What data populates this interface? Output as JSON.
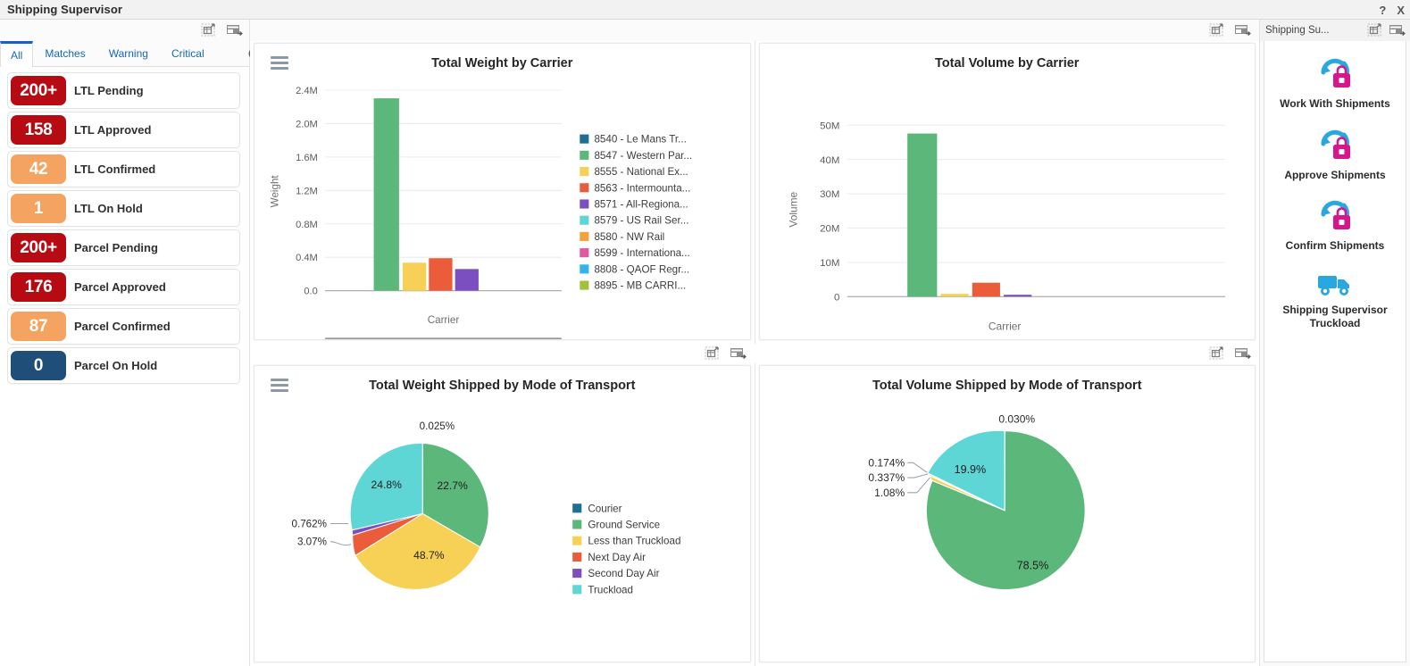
{
  "window": {
    "title": "Shipping Supervisor",
    "help_label": "?",
    "close_label": "X"
  },
  "left_panel": {
    "toolbar_icons": [
      "expand-grid-icon",
      "add-panel-icon"
    ],
    "tabs": [
      {
        "label": "All",
        "active": true
      },
      {
        "label": "Matches",
        "active": false
      },
      {
        "label": "Warning",
        "active": false
      },
      {
        "label": "Critical",
        "active": false
      }
    ],
    "refresh_icon": "refresh-icon",
    "kpis": [
      {
        "count": "200+",
        "label": "LTL Pending",
        "color": "#b60b12"
      },
      {
        "count": "158",
        "label": "LTL Approved",
        "color": "#b60b12"
      },
      {
        "count": "42",
        "label": "LTL Confirmed",
        "color": "#f4a460"
      },
      {
        "count": "1",
        "label": "LTL On Hold",
        "color": "#f4a460"
      },
      {
        "count": "200+",
        "label": "Parcel Pending",
        "color": "#b60b12"
      },
      {
        "count": "176",
        "label": "Parcel Approved",
        "color": "#b60b12"
      },
      {
        "count": "87",
        "label": "Parcel Confirmed",
        "color": "#f4a460"
      },
      {
        "count": "0",
        "label": "Parcel On Hold",
        "color": "#1f4e79"
      }
    ]
  },
  "right_panel": {
    "title": "Shipping Su...",
    "toolbar_icons": [
      "expand-grid-icon",
      "add-panel-icon"
    ],
    "apps": [
      {
        "label": "Work With Shipments",
        "icon": "shipments-briefcase-icon"
      },
      {
        "label": "Approve Shipments",
        "icon": "shipments-briefcase-icon"
      },
      {
        "label": "Confirm Shipments",
        "icon": "shipments-briefcase-icon"
      },
      {
        "label": "Shipping Supervisor Truckload",
        "icon": "truck-icon"
      }
    ]
  },
  "panel_toolbars": {
    "icons": [
      "expand-grid-icon",
      "add-panel-icon"
    ]
  },
  "chart_data": [
    {
      "type": "bar",
      "title": "Total Weight by Carrier",
      "xlabel": "Carrier",
      "ylabel": "Weight",
      "ylim": [
        0,
        2.4
      ],
      "yticks": [
        "0.0",
        "0.4M",
        "0.8M",
        "1.2M",
        "1.6M",
        "2.0M",
        "2.4M"
      ],
      "ytick_values": [
        0,
        0.4,
        0.8,
        1.2,
        1.6,
        2.0,
        2.4
      ],
      "grid": true,
      "legend_position": "right",
      "categories": [
        "8540 - Le Mans Tr...",
        "8547 - Western Par...",
        "8555 - National Ex...",
        "8563 - Intermounta...",
        "8571 - All-Regiona...",
        "8579 - US Rail Ser...",
        "8580 - NW Rail",
        "8599 - Internationa...",
        "8808 - QAOF Regr...",
        "8895 - MB CARRI..."
      ],
      "colors": [
        "#1f6f94",
        "#5cb87a",
        "#f6d155",
        "#ea5c3a",
        "#7c4fc0",
        "#5fd6d6",
        "#f5a23c",
        "#e2589f",
        "#32b4e8",
        "#a4c13a"
      ],
      "values": [
        0,
        2.3,
        0.34,
        0.39,
        0.26,
        0,
        0,
        0,
        0,
        0
      ]
    },
    {
      "type": "bar",
      "title": "Total Volume by Carrier",
      "xlabel": "Carrier",
      "ylabel": "Volume",
      "ylim": [
        0,
        50
      ],
      "yticks": [
        "0",
        "10M",
        "20M",
        "30M",
        "40M",
        "50M"
      ],
      "ytick_values": [
        0,
        10,
        20,
        30,
        40,
        50
      ],
      "grid": true,
      "legend_position": "none",
      "categories": [
        "8540 - Le Mans Tr...",
        "8547 - Western Par...",
        "8555 - National Ex...",
        "8563 - Intermounta...",
        "8571 - All-Regiona..."
      ],
      "colors": [
        "#1f6f94",
        "#5cb87a",
        "#f6d155",
        "#ea5c3a",
        "#7c4fc0"
      ],
      "values": [
        0,
        47.5,
        0.3,
        4.2,
        0.25
      ]
    },
    {
      "type": "pie",
      "title": "Total Weight Shipped by Mode of Transport",
      "legend_position": "right",
      "labels": [
        "Courier",
        "Ground Service",
        "Less than Truckload",
        "Next Day Air",
        "Second Day Air",
        "Truckload"
      ],
      "colors": [
        "#1f6f94",
        "#5cb87a",
        "#f6d155",
        "#ea5c3a",
        "#7c4fc0",
        "#5fd6d6"
      ],
      "values": [
        0.025,
        22.7,
        48.7,
        3.07,
        0.762,
        24.8
      ],
      "value_labels": [
        "0.025%",
        "22.7%",
        "48.7%",
        "3.07%",
        "0.762%",
        "24.8%"
      ],
      "inside_labels": [
        "22.7%",
        "48.7%",
        "24.8%"
      ],
      "outside_labels": [
        "0.025%",
        "3.07%",
        "0.762%"
      ]
    },
    {
      "type": "pie",
      "title": "Total Volume Shipped by Mode of Transport",
      "legend_position": "none",
      "labels": [
        "Courier",
        "Ground Service",
        "Less than Truckload",
        "Next Day Air",
        "Second Day Air",
        "Truckload"
      ],
      "colors": [
        "#1f6f94",
        "#5cb87a",
        "#f6d155",
        "#ea5c3a",
        "#7c4fc0",
        "#5fd6d6"
      ],
      "values": [
        0.03,
        78.5,
        1.08,
        0.337,
        0.174,
        19.9
      ],
      "value_labels": [
        "0.030%",
        "78.5%",
        "1.08%",
        "0.337%",
        "0.174%",
        "19.9%"
      ],
      "inside_labels": [
        "78.5%",
        "19.9%"
      ],
      "outside_labels": [
        "0.030%",
        "0.174%",
        "0.337%",
        "1.08%"
      ]
    }
  ]
}
